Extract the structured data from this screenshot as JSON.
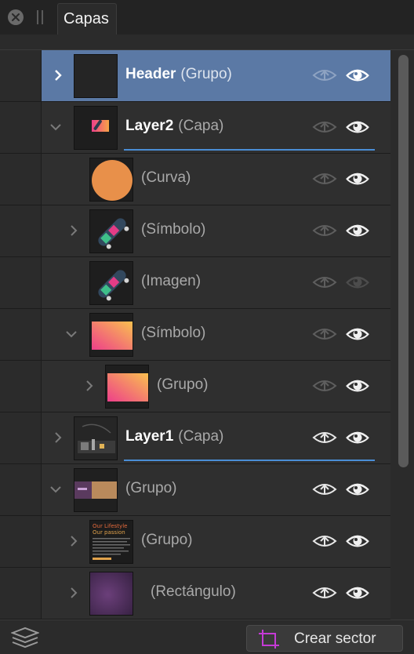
{
  "panel": {
    "tab_label": "Capas"
  },
  "layers": [
    {
      "name": "Header",
      "type": "(Grupo)",
      "expanded": false,
      "selected": true,
      "bold": true,
      "lock_active": false,
      "visible": true
    },
    {
      "name": "Layer2",
      "type": "(Capa)",
      "expanded": true,
      "selected": false,
      "bold": true,
      "lock_active": false,
      "visible": true
    },
    {
      "name": "",
      "type": "(Curva)",
      "expanded": null,
      "selected": false,
      "bold": false,
      "lock_active": false,
      "visible": true
    },
    {
      "name": "",
      "type": "(Símbolo)",
      "expanded": false,
      "selected": false,
      "bold": false,
      "lock_active": false,
      "visible": true
    },
    {
      "name": "",
      "type": "(Imagen)",
      "expanded": null,
      "selected": false,
      "bold": false,
      "lock_active": false,
      "visible": false
    },
    {
      "name": "",
      "type": "(Símbolo)",
      "expanded": true,
      "selected": false,
      "bold": false,
      "lock_active": false,
      "visible": true
    },
    {
      "name": "",
      "type": "(Grupo)",
      "expanded": false,
      "selected": false,
      "bold": false,
      "lock_active": false,
      "visible": true
    },
    {
      "name": "Layer1",
      "type": "(Capa)",
      "expanded": false,
      "selected": false,
      "bold": true,
      "lock_active": true,
      "visible": true
    },
    {
      "name": "",
      "type": "(Grupo)",
      "expanded": true,
      "selected": false,
      "bold": false,
      "lock_active": true,
      "visible": true
    },
    {
      "name": "",
      "type": "(Grupo)",
      "expanded": false,
      "selected": false,
      "bold": false,
      "lock_active": true,
      "visible": true
    },
    {
      "name": "",
      "type": "(Rectángulo)",
      "expanded": false,
      "selected": false,
      "bold": false,
      "lock_active": true,
      "visible": true
    }
  ],
  "thumb_text": {
    "line1": "Our Lifestyle",
    "line2": "Our passion"
  },
  "footer": {
    "create_slice_label": "Crear sector"
  },
  "colors": {
    "selection": "#5b79a5",
    "active_underline": "#4a8ed6",
    "slice_icon": "#c53ad6"
  }
}
